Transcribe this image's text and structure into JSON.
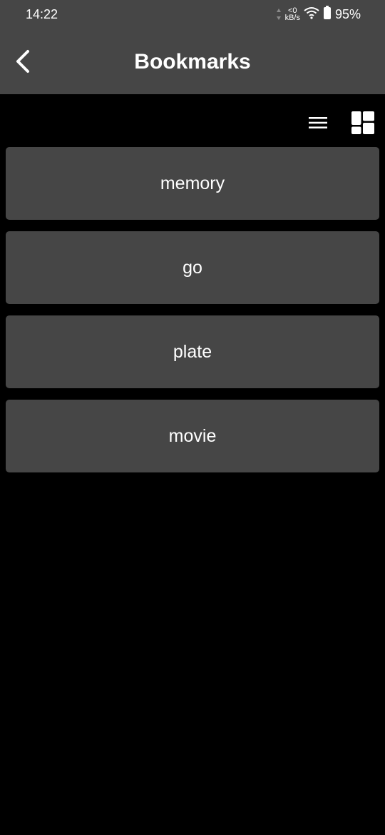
{
  "status_bar": {
    "time": "14:22",
    "net_speed_value": "0",
    "net_speed_unit": "kB/s",
    "net_speed_prefix": "<",
    "battery_percent": "95%",
    "icons": [
      "network-activity-icon",
      "wifi-icon",
      "battery-icon"
    ]
  },
  "header": {
    "title": "Bookmarks",
    "back_icon": "chevron-left-icon"
  },
  "toolbar": {
    "list_view_icon": "list-view-icon",
    "grid_view_icon": "grid-view-icon"
  },
  "bookmarks": {
    "items": [
      {
        "label": "memory"
      },
      {
        "label": "go"
      },
      {
        "label": "plate"
      },
      {
        "label": "movie"
      }
    ]
  },
  "colors": {
    "background": "#000000",
    "surface": "#464646",
    "text": "#ffffff"
  }
}
